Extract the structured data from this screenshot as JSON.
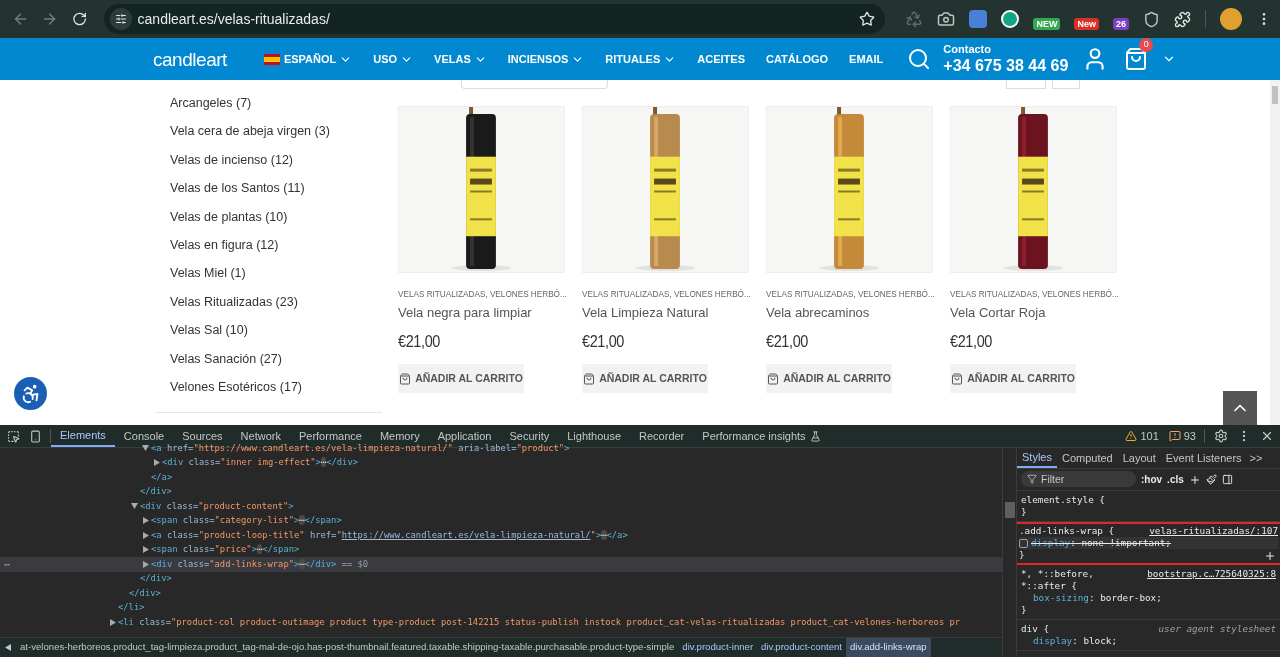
{
  "browser": {
    "url": "candleart.es/velas-ritualizadas/",
    "extension_badges": [
      {
        "text": "NEW",
        "color": "#34a853"
      },
      {
        "text": "New",
        "color": "#d93025"
      },
      {
        "text": "26",
        "color": "#7b3fc4"
      }
    ]
  },
  "site_nav": {
    "logo": "candleart",
    "language": "ESPAÑOL",
    "menu": [
      {
        "label": "USO",
        "dropdown": true
      },
      {
        "label": "VELAS",
        "dropdown": true
      },
      {
        "label": "INCIENSOS",
        "dropdown": true
      },
      {
        "label": "RITUALES",
        "dropdown": true
      },
      {
        "label": "ACEITES",
        "dropdown": false
      },
      {
        "label": "CATÁLOGO",
        "dropdown": false
      },
      {
        "label": "EMAIL",
        "dropdown": false
      }
    ],
    "contact_label": "Contacto",
    "phone": "+34 675 38 44 69",
    "cart_count": "0"
  },
  "sidebar": {
    "categories": [
      "Arcangeles (7)",
      "Vela cera de abeja virgen (3)",
      "Velas de incienso (12)",
      "Velas de los Santos (11)",
      "Velas de plantas (10)",
      "Velas en figura (12)",
      "Velas Miel (1)",
      "Velas Ritualizadas (23)",
      "Velas Sal (10)",
      "Velas Sanación (27)",
      "Velones Esotéricos (17)"
    ]
  },
  "products": [
    {
      "category": "VELAS RITUALIZADAS, VELONES HERBÓ...",
      "name": "Vela negra para limpiar",
      "price": "€21,00",
      "button": "AÑADIR AL CARRITO"
    },
    {
      "category": "VELAS RITUALIZADAS, VELONES HERBÓ...",
      "name": "Vela Limpieza Natural",
      "price": "€21,00",
      "button": "AÑADIR AL CARRITO"
    },
    {
      "category": "VELAS RITUALIZADAS, VELONES HERBÓ...",
      "name": "Vela abrecaminos",
      "price": "€21,00",
      "button": "AÑADIR AL CARRITO"
    },
    {
      "category": "VELAS RITUALIZADAS, VELONES HERBÓ...",
      "name": "Vela Cortar Roja",
      "price": "€21,00",
      "button": "AÑADIR AL CARRITO"
    }
  ],
  "devtools": {
    "tabs": [
      {
        "label": "Elements",
        "selected": true
      },
      {
        "label": "Console",
        "selected": false
      },
      {
        "label": "Sources",
        "selected": false
      },
      {
        "label": "Network",
        "selected": false
      },
      {
        "label": "Performance",
        "selected": false
      },
      {
        "label": "Memory",
        "selected": false
      },
      {
        "label": "Application",
        "selected": false
      },
      {
        "label": "Security",
        "selected": false
      },
      {
        "label": "Lighthouse",
        "selected": false
      },
      {
        "label": "Recorder",
        "selected": false
      },
      {
        "label": "Performance insights",
        "selected": false
      }
    ],
    "warnings": "101",
    "issues": "93",
    "dom": [
      {
        "children": [
          {
            "children": [
              {
                "children": [
                  {
                    "text": "<a href=\"https://www.candleart.es/vela-limpieza-natural/\" aria-label=\"product\">",
                    "expanded": true,
                    "children": [
                      {
                        "text": "<div class=\"inner img-effect\">⋯</div>",
                        "expanded": false
                      }
                    ]
                  },
                  {
                    "text": "</a>"
                  }
                ]
              },
              {
                "text": "</div>"
              },
              {
                "text": "<div class=\"product-content\">",
                "expanded": true,
                "children": [
                  {
                    "text": "<span class=\"category-list\">⋯</span>",
                    "expanded": false
                  },
                  {
                    "text": "<a class=\"product-loop-title\" href=\"",
                    "link": "https://www.candleart.es/vela-limpieza-natural/",
                    "rest": "\">⋯</a>",
                    "expanded": false
                  },
                  {
                    "text": "<span class=\"price\">⋯</span>",
                    "expanded": false
                  },
                  {
                    "text": "<div class=\"add-links-wrap\">⋯</div>",
                    "expanded": false,
                    "selected": true,
                    "suffix": "== $0",
                    "gutter": "⋯"
                  }
                ]
              },
              {
                "text": "</div>"
              }
            ]
          },
          {
            "text": "</div>"
          }
        ]
      },
      {
        "text": "</li>"
      },
      {
        "text": "<li class=\"product-col product-outimage product type-product post-142215 status-publish instock product_cat-velas-ritualizadas product_cat-velones-herboreos pr",
        "expanded": false
      }
    ],
    "breadcrumbs": [
      {
        "label": "at-velones-herboreos.product_tag-limpieza.product_tag-mal-de-ojo.has-post-thumbnail.featured.taxable.shipping-taxable.purchasable.product-type-simple",
        "selected": false
      },
      {
        "label": "div.product-inner",
        "selected": false
      },
      {
        "label": "div.product-content",
        "selected": false
      },
      {
        "label": "div.add-links-wrap",
        "selected": true
      }
    ],
    "styles": {
      "tabs": [
        {
          "label": "Styles",
          "selected": true
        },
        {
          "label": "Computed",
          "selected": false
        },
        {
          "label": "Layout",
          "selected": false
        },
        {
          "label": "Event Listeners",
          "selected": false
        }
      ],
      "more": ">>",
      "filter_placeholder": "Filter",
      "hov": ":hov",
      "cls": ".cls",
      "rules": [
        {
          "selector": "element.style {",
          "close": "}"
        },
        {
          "selector": ".add-links-wrap {",
          "source": "velas-ritualizadas/:107",
          "close": "}",
          "highlighted": true,
          "declarations": [
            {
              "property": "display",
              "colon": ":",
              "value": "none !important;",
              "checked": false
            }
          ]
        },
        {
          "selector": "*, *::before,",
          "selector_2": "*::after {",
          "source": "bootstrap.c…725640325:8",
          "close": "}",
          "declarations": [
            {
              "property": "box-sizing",
              "colon": ":",
              "value": "border-box;"
            }
          ]
        },
        {
          "selector": "div {",
          "source": "user agent stylesheet",
          "user_agent": true,
          "declarations": [
            {
              "property": "display",
              "colon": ":",
              "value": "block;"
            }
          ]
        }
      ]
    }
  }
}
